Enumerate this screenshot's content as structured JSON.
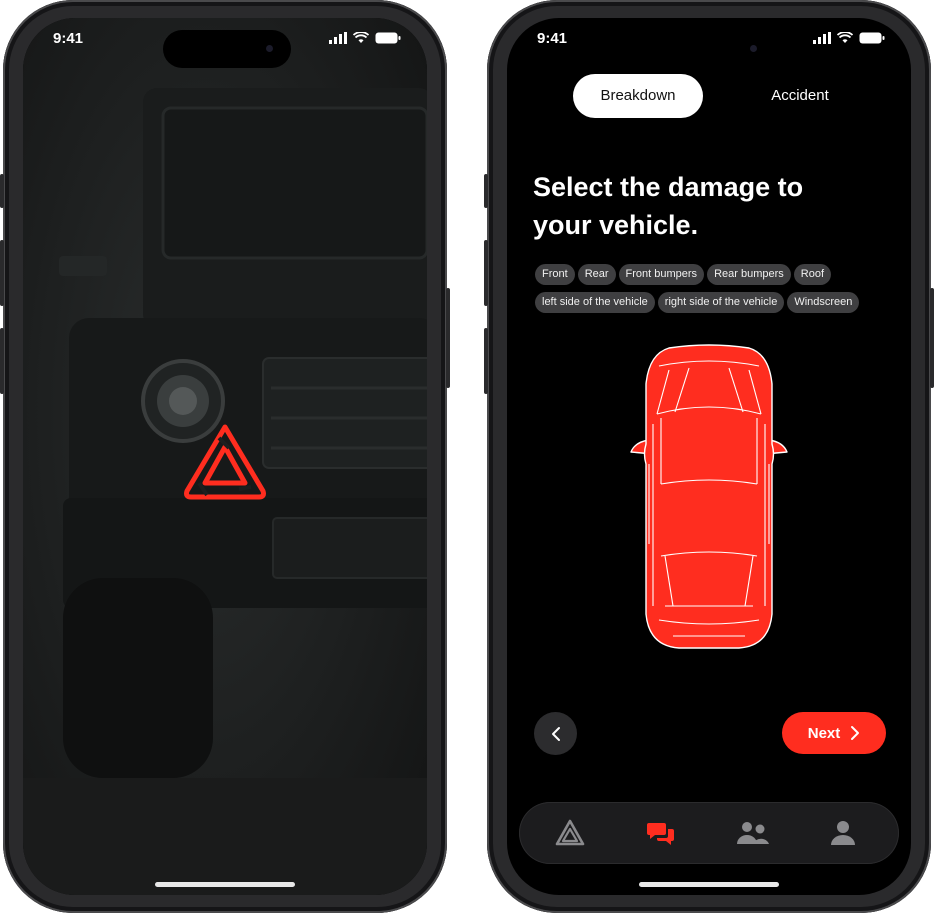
{
  "status_bar": {
    "time_left": "9:41",
    "time_right": "9:41"
  },
  "splash": {
    "logo": "warning-triangle-icon",
    "accent": "#ff2d1f"
  },
  "damage_screen": {
    "tabs": [
      {
        "label": "Breakdown",
        "active": true
      },
      {
        "label": "Accident",
        "active": false
      }
    ],
    "title_line1": "Select the damage to",
    "title_line2": "your vehicle.",
    "chips": [
      "Front",
      "Rear",
      "Front bumpers",
      "Rear bumpers",
      "Roof",
      "left side of the vehicle",
      "right side of the vehicle",
      "Windscreen"
    ],
    "next_label": "Next",
    "accent": "#ff2d1f"
  },
  "tabbar": {
    "items": [
      {
        "icon": "warning-triangle-icon",
        "active": false
      },
      {
        "icon": "chat-bubbles-icon",
        "active": true
      },
      {
        "icon": "group-icon",
        "active": false
      },
      {
        "icon": "profile-icon",
        "active": false
      }
    ]
  }
}
